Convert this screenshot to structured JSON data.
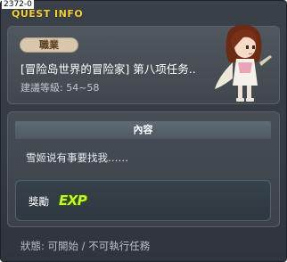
{
  "window": {
    "id_label": "2372-0",
    "title": "QUEST INFO"
  },
  "quest": {
    "job_badge": "職業",
    "name": "[冒险岛世界的冒险家] 第八项任务..",
    "level_text": "建議等級: 54~58"
  },
  "content": {
    "header": "內容",
    "description": "雪姬说有事要找我……"
  },
  "reward": {
    "label": "獎勵",
    "icon": "exp-icon",
    "icon_text": "EXP"
  },
  "status": {
    "text": "狀態: 可開始 / 不可執行任務"
  },
  "colors": {
    "title": "#f2d33a",
    "exp": "#c8f03a",
    "badge": "#d8c7ad"
  }
}
